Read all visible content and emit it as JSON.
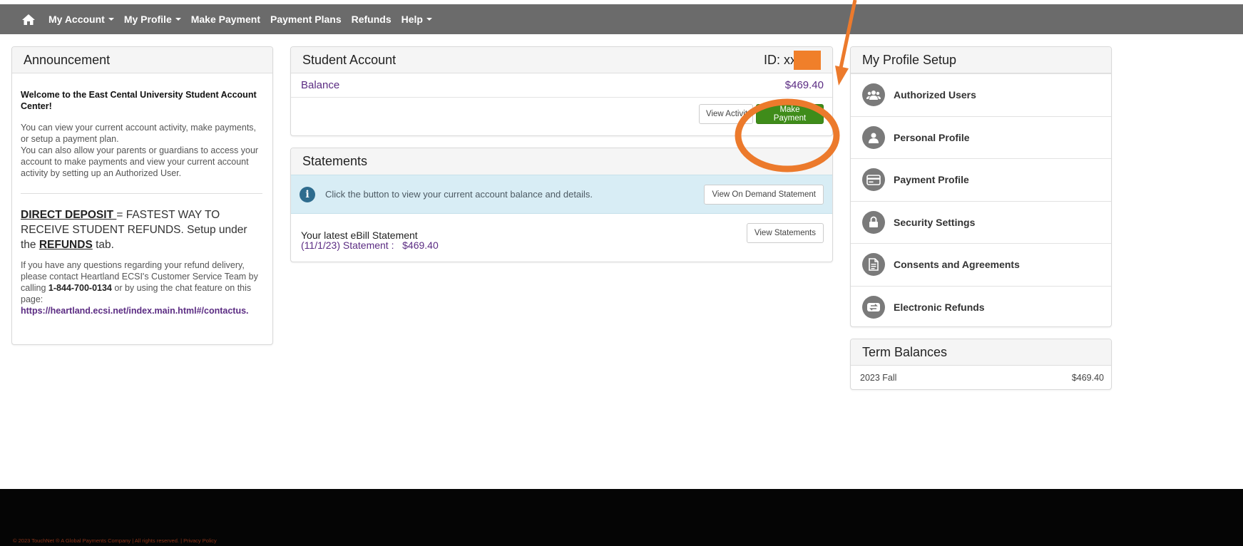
{
  "nav": {
    "home_icon": "home-icon",
    "items": [
      {
        "label": "My Account",
        "dropdown": true
      },
      {
        "label": "My Profile",
        "dropdown": true
      },
      {
        "label": "Make Payment",
        "dropdown": false
      },
      {
        "label": "Payment Plans",
        "dropdown": false
      },
      {
        "label": "Refunds",
        "dropdown": false
      },
      {
        "label": "Help",
        "dropdown": true
      }
    ]
  },
  "announcement": {
    "title": "Announcement",
    "welcome": "Welcome to the East Cental University Student Account Center!",
    "para1": "You can view your current account activity, make payments, or setup a payment plan.",
    "para2": "You can also allow your parents or guardians to access your account to make payments and view your current account activity by setting up an Authorized User.",
    "direct_deposit": "DIRECT DEPOSIT ",
    "dd_rest": "= FASTEST WAY TO RECEIVE STUDENT REFUNDS. Setup under the ",
    "refunds_word": "REFUNDS",
    "tab_word": " tab.",
    "question_pre": "If you have any questions regarding your refund delivery, please contact Heartland ECSI's Customer Service Team by calling ",
    "phone": "1-844-700-0134",
    "question_post": " or by using the chat feature on this page:",
    "link": "https://heartland.ecsi.net/index.main.html#/contactus."
  },
  "student_account": {
    "title": "Student Account",
    "id_label": "ID: xx",
    "balance_label": "Balance",
    "balance_value": "$469.40",
    "view_activity": "View Activity",
    "make_payment": "Make Payment"
  },
  "statements": {
    "title": "Statements",
    "info_text": "Click the button to view your current account balance and details.",
    "on_demand_button": "View On Demand Statement",
    "latest_label": "Your latest eBill Statement",
    "latest_detail": "(11/1/23) Statement :   $469.40",
    "view_statements_button": "View Statements"
  },
  "profile": {
    "title": "My Profile Setup",
    "items": [
      {
        "label": "Authorized Users",
        "icon": "users-icon"
      },
      {
        "label": "Personal Profile",
        "icon": "person-icon"
      },
      {
        "label": "Payment Profile",
        "icon": "credit-card-icon"
      },
      {
        "label": "Security Settings",
        "icon": "lock-icon"
      },
      {
        "label": "Consents and Agreements",
        "icon": "document-icon"
      },
      {
        "label": "Electronic Refunds",
        "icon": "refund-icon"
      }
    ]
  },
  "terms": {
    "title": "Term Balances",
    "rows": [
      {
        "term": "2023 Fall",
        "amount": "$469.40"
      }
    ]
  },
  "footer": {
    "text": "© 2023 TouchNet ® A Global Payments Company | All rights reserved. | Privacy Policy"
  },
  "colors": {
    "nav_bg": "#6b6b6b",
    "accent_purple": "#5b2c83",
    "button_green": "#3f8c1a",
    "info_bg": "#d8edf5",
    "annotation_orange": "#ec7a2c"
  }
}
